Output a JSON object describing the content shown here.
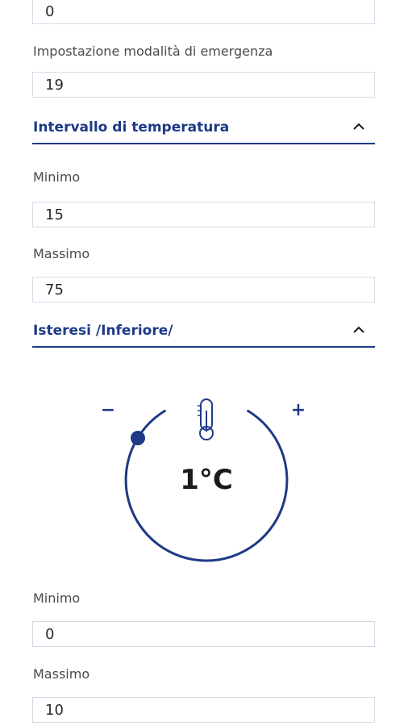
{
  "top_field": {
    "value": "0"
  },
  "emergency": {
    "label": "Impostazione modalità di emergenza",
    "value": "19"
  },
  "temp_range": {
    "title": "Intervallo di temperatura",
    "min_label": "Minimo",
    "min_value": "15",
    "max_label": "Massimo",
    "max_value": "75"
  },
  "hysteresis": {
    "title": "Isteresi /Inferiore/",
    "dial": {
      "minus": "−",
      "plus": "+",
      "value": "1°C",
      "icon": "thermometer-icon"
    },
    "min_label": "Minimo",
    "min_value": "0",
    "max_label": "Massimo",
    "max_value": "10"
  },
  "colors": {
    "accent": "#1d3a87",
    "border": "#d4dbe8"
  }
}
